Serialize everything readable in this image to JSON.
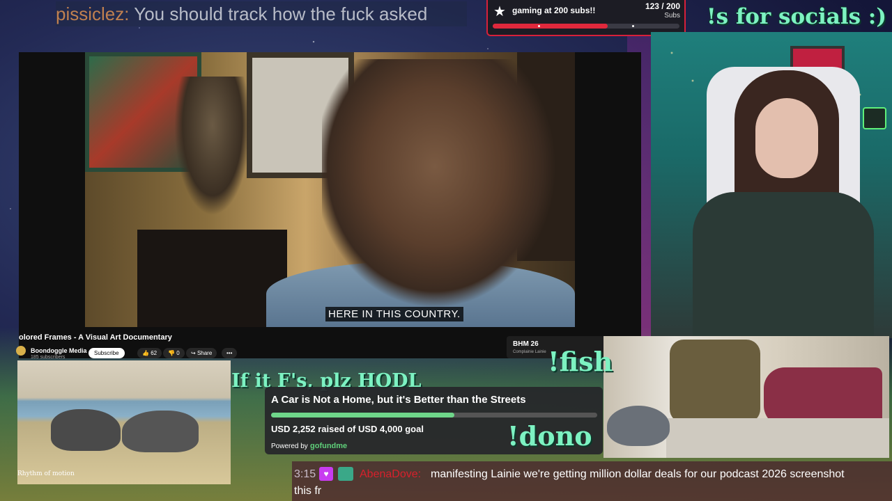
{
  "ticker": {
    "user": "pissiclez:",
    "message": "You should track how the fuck asked"
  },
  "goal": {
    "title": "gaming at 200 subs!!",
    "count": "123 / 200",
    "unit": "Subs",
    "progress": 0.615,
    "accent": "#e0283c"
  },
  "socials_text": "!s for socials :)",
  "video": {
    "subtitle": "HERE IN THIS COUNTRY.",
    "title": "olored Frames - A Visual Art Documentary",
    "channel": "Boondoggle Media",
    "subscribers": "185 subscribers",
    "subscribe_label": "Subscribe",
    "likes": "62",
    "dislikes": "0",
    "share_label": "Share",
    "more_label": "•••",
    "playlist_title": "BHM 26",
    "playlist_sub": "Complainie Lainie"
  },
  "nature_logo": "Rhythm of motion",
  "hodl_text": "If it F's, plz HODL",
  "gofundme": {
    "title": "A Car is Not a Home, but it's Better than the Streets",
    "raised": "USD 2,252 raised of USD 4,000 goal",
    "progress": 0.563,
    "powered_by": "Powered by",
    "brand": "gofundme",
    "accent": "#6fd68a"
  },
  "commands": {
    "fish": "!fish",
    "dono": "!dono"
  },
  "chat": {
    "time": "3:15",
    "user": "AbenaDove:",
    "message_line1": "manifesting Lainie we're getting million dollar deals for our podcast 2026 screenshot",
    "message_line2": "this fr"
  }
}
